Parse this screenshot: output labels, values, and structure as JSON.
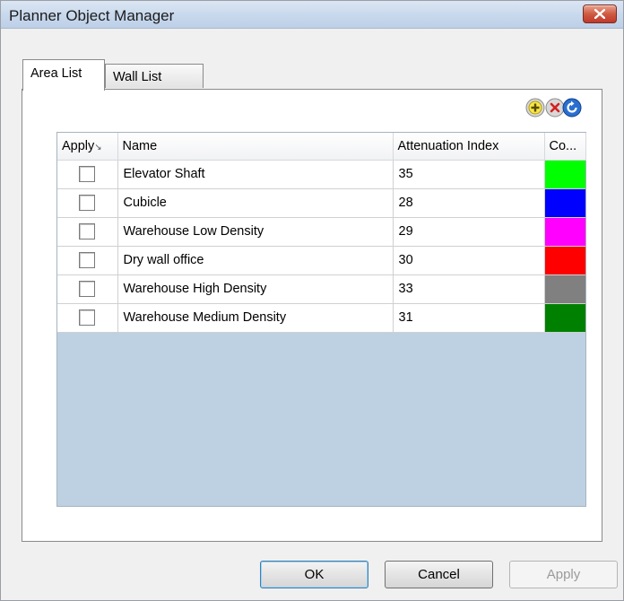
{
  "window": {
    "title": "Planner Object Manager",
    "close_icon": "close-icon"
  },
  "tabs": [
    {
      "label": "Area List",
      "active": true
    },
    {
      "label": "Wall List",
      "active": false
    }
  ],
  "toolbar": {
    "add_icon": "add-icon",
    "delete_icon": "delete-icon",
    "refresh_icon": "refresh-icon"
  },
  "grid": {
    "columns": [
      "Apply",
      "Name",
      "Attenuation Index",
      "Co..."
    ],
    "rows": [
      {
        "apply": false,
        "name": "Elevator Shaft",
        "attenuation": "35",
        "color": "#00ff00"
      },
      {
        "apply": false,
        "name": "Cubicle",
        "attenuation": "28",
        "color": "#0000ff"
      },
      {
        "apply": false,
        "name": "Warehouse Low Density",
        "attenuation": "29",
        "color": "#ff00ff"
      },
      {
        "apply": false,
        "name": "Dry wall office",
        "attenuation": "30",
        "color": "#ff0000"
      },
      {
        "apply": false,
        "name": "Warehouse High Density",
        "attenuation": "33",
        "color": "#808080"
      },
      {
        "apply": false,
        "name": "Warehouse Medium Density",
        "attenuation": "31",
        "color": "#008000"
      }
    ],
    "empty_area_color": "#bdd1e2"
  },
  "buttons": {
    "ok": "OK",
    "cancel": "Cancel",
    "apply": "Apply"
  }
}
